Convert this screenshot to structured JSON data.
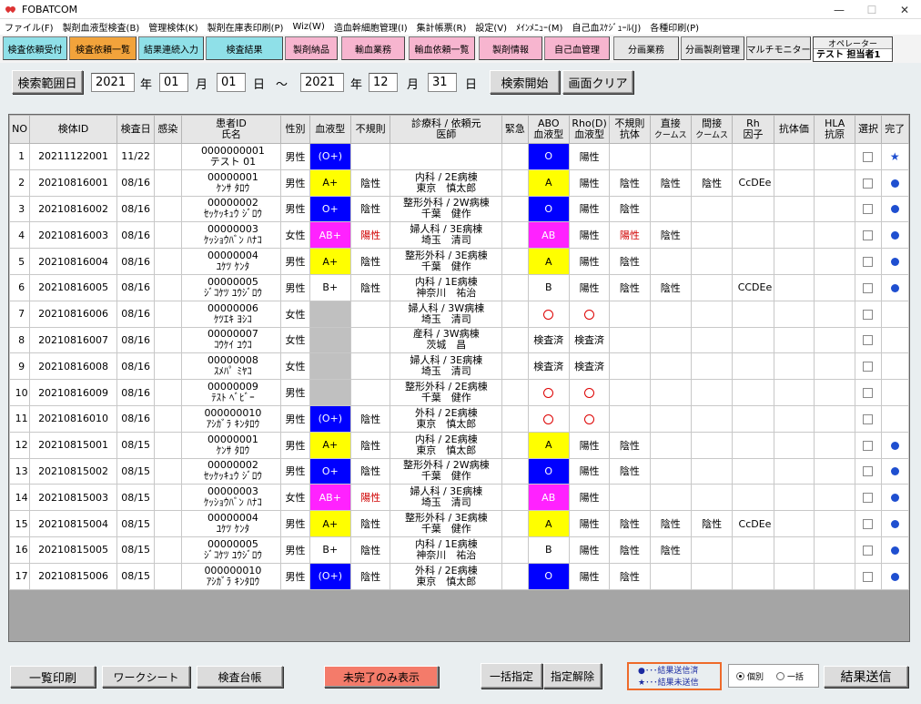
{
  "window": {
    "title": "FOBATCOM"
  },
  "menu": [
    "ファイル(F)",
    "製剤血液型検査(B)",
    "管理検体(K)",
    "製剤在庫表印刷(P)",
    "Wiz(W)",
    "造血幹細胞管理(I)",
    "集計帳票(R)",
    "設定(V)",
    "ﾒｲﾝﾒﾆｭｰ(M)",
    "自己血ｽｹｼﾞｭｰﾙ(J)",
    "各種印刷(P)"
  ],
  "tabs": [
    "検査依頼受付",
    "検査依頼一覧",
    "結果連続入力",
    "検査結果",
    "製剤納品",
    "輸血業務",
    "輸血依頼一覧",
    "製剤情報",
    "自己血管理",
    "分画業務",
    "分画製剤管理",
    "マルチモニター"
  ],
  "operator": {
    "label": "オペレーター",
    "name": "テスト 担当者1"
  },
  "search": {
    "range_button": "検索範囲日",
    "from_year": "2021",
    "from_month": "01",
    "from_day": "01",
    "to_year": "2021",
    "to_month": "12",
    "to_day": "31",
    "year_label": "年",
    "month_label": "月",
    "day_label": "日",
    "tilde": "～",
    "start_button": "検索開始",
    "clear_button": "画面クリア"
  },
  "columns": {
    "no": "NO",
    "sample_id": "検体ID",
    "exam_date": "検査日",
    "infection": "感染",
    "patient_id": "患者ID",
    "patient_name": "氏名",
    "sex": "性別",
    "blood_type": "血液型",
    "irregular": "不規則",
    "dept": "診療科 / 依頼元",
    "doctor": "医師",
    "urgent": "緊急",
    "abo1": "ABO",
    "abo2": "血液型",
    "rho1": "Rho(D)",
    "rho2": "血液型",
    "irr_ab1": "不規則",
    "irr_ab2": "抗体",
    "direct1": "直接",
    "direct2": "クームス",
    "indirect1": "間接",
    "indirect2": "クームス",
    "rh1": "Rh",
    "rh2": "因子",
    "titer": "抗体価",
    "hla1": "HLA",
    "hla2": "抗原",
    "select": "選択",
    "done": "完了"
  },
  "rows": [
    {
      "no": "1",
      "sid": "20211122001",
      "date": "11/22",
      "pid": "0000000001",
      "name": "テスト 01",
      "sex": "男性",
      "bt": "(O+)",
      "btc": "blue",
      "irr": "",
      "irrRed": false,
      "dept": "",
      "doc": "",
      "abo": "O",
      "aboc": "blue",
      "rho": "陽性",
      "irrab": "",
      "irrabRed": false,
      "direct": "",
      "indirect": "",
      "rh": "",
      "mark": "star"
    },
    {
      "no": "2",
      "sid": "20210816001",
      "date": "08/16",
      "pid": "00000001",
      "name": "ｹﾝｻ ﾀﾛｳ",
      "sex": "男性",
      "bt": "A+",
      "btc": "yellow",
      "irr": "陰性",
      "irrRed": false,
      "dept": "内科 / 2E病棟",
      "doc": "東京　慎太郎",
      "abo": "A",
      "aboc": "yellow",
      "rho": "陽性",
      "irrab": "陰性",
      "irrabRed": false,
      "direct": "陰性",
      "indirect": "陰性",
      "rh": "CcDEe",
      "mark": "dot"
    },
    {
      "no": "3",
      "sid": "20210816002",
      "date": "08/16",
      "pid": "00000002",
      "name": "ｾｯｹｯｷｭｳ ｼﾞﾛｳ",
      "sex": "男性",
      "bt": "O+",
      "btc": "blue",
      "irr": "陰性",
      "irrRed": false,
      "dept": "整形外科 / 2W病棟",
      "doc": "千葉　健作",
      "abo": "O",
      "aboc": "blue",
      "rho": "陽性",
      "irrab": "陰性",
      "irrabRed": false,
      "direct": "",
      "indirect": "",
      "rh": "",
      "mark": "dot"
    },
    {
      "no": "4",
      "sid": "20210816003",
      "date": "08/16",
      "pid": "00000003",
      "name": "ｹｯｼｮｳﾊﾞﾝ ﾊﾅｺ",
      "sex": "女性",
      "bt": "AB+",
      "btc": "magenta",
      "irr": "陽性",
      "irrRed": true,
      "dept": "婦人科 / 3E病棟",
      "doc": "埼玉　清司",
      "abo": "AB",
      "aboc": "magenta",
      "rho": "陽性",
      "irrab": "陽性",
      "irrabRed": true,
      "direct": "陰性",
      "indirect": "",
      "rh": "",
      "mark": "dot"
    },
    {
      "no": "5",
      "sid": "20210816004",
      "date": "08/16",
      "pid": "00000004",
      "name": "ﾕｹﾂ ｹﾝﾀ",
      "sex": "男性",
      "bt": "A+",
      "btc": "yellow",
      "irr": "陰性",
      "irrRed": false,
      "dept": "整形外科 / 3E病棟",
      "doc": "千葉　健作",
      "abo": "A",
      "aboc": "yellow",
      "rho": "陽性",
      "irrab": "陰性",
      "irrabRed": false,
      "direct": "",
      "indirect": "",
      "rh": "",
      "mark": "dot"
    },
    {
      "no": "6",
      "sid": "20210816005",
      "date": "08/16",
      "pid": "00000005",
      "name": "ｼﾞｺｹﾂ ﾕｳｼﾞﾛｳ",
      "sex": "男性",
      "bt": "B+",
      "btc": "",
      "irr": "陰性",
      "irrRed": false,
      "dept": "内科 / 1E病棟",
      "doc": "神奈川　祐治",
      "abo": "B",
      "aboc": "",
      "rho": "陽性",
      "irrab": "陰性",
      "irrabRed": false,
      "direct": "陰性",
      "indirect": "",
      "rh": "CCDEe",
      "mark": "dot"
    },
    {
      "no": "7",
      "sid": "20210816006",
      "date": "08/16",
      "pid": "00000006",
      "name": "ｹﾂｴｷ ﾖｼｺ",
      "sex": "女性",
      "bt": "",
      "btc": "gray",
      "irr": "",
      "irrRed": false,
      "dept": "婦人科 / 3W病棟",
      "doc": "埼玉　清司",
      "abo": "ring",
      "aboc": "",
      "rho": "ring",
      "irrab": "",
      "irrabRed": false,
      "direct": "",
      "indirect": "",
      "rh": "",
      "mark": ""
    },
    {
      "no": "8",
      "sid": "20210816007",
      "date": "08/16",
      "pid": "00000007",
      "name": "ｺｳｹｲ ﾕｳｺ",
      "sex": "女性",
      "bt": "",
      "btc": "gray",
      "irr": "",
      "irrRed": false,
      "dept": "産科 / 3W病棟",
      "doc": "茨城　昌",
      "abo": "検査済",
      "aboc": "",
      "rho": "検査済",
      "irrab": "",
      "irrabRed": false,
      "direct": "",
      "indirect": "",
      "rh": "",
      "mark": ""
    },
    {
      "no": "9",
      "sid": "20210816008",
      "date": "08/16",
      "pid": "00000008",
      "name": "ｽﾒﾊﾟ ﾐﾔｺ",
      "sex": "女性",
      "bt": "",
      "btc": "gray",
      "irr": "",
      "irrRed": false,
      "dept": "婦人科 / 3E病棟",
      "doc": "埼玉　清司",
      "abo": "検査済",
      "aboc": "",
      "rho": "検査済",
      "irrab": "",
      "irrabRed": false,
      "direct": "",
      "indirect": "",
      "rh": "",
      "mark": ""
    },
    {
      "no": "10",
      "sid": "20210816009",
      "date": "08/16",
      "pid": "00000009",
      "name": "ﾃｽﾄ ﾍﾞﾋﾞｰ",
      "sex": "男性",
      "bt": "",
      "btc": "gray",
      "irr": "",
      "irrRed": false,
      "dept": "整形外科 / 2E病棟",
      "doc": "千葉　健作",
      "abo": "ring",
      "aboc": "",
      "rho": "ring",
      "irrab": "",
      "irrabRed": false,
      "direct": "",
      "indirect": "",
      "rh": "",
      "mark": ""
    },
    {
      "no": "11",
      "sid": "20210816010",
      "date": "08/16",
      "pid": "000000010",
      "name": "ｱｼｶﾞﾗ ｷﾝﾀﾛｳ",
      "sex": "男性",
      "bt": "(O+)",
      "btc": "blue",
      "irr": "陰性",
      "irrRed": false,
      "dept": "外科 / 2E病棟",
      "doc": "東京　慎太郎",
      "abo": "ring",
      "aboc": "",
      "rho": "ring",
      "irrab": "",
      "irrabRed": false,
      "direct": "",
      "indirect": "",
      "rh": "",
      "mark": ""
    },
    {
      "no": "12",
      "sid": "20210815001",
      "date": "08/15",
      "pid": "00000001",
      "name": "ｹﾝｻ ﾀﾛｳ",
      "sex": "男性",
      "bt": "A+",
      "btc": "yellow",
      "irr": "陰性",
      "irrRed": false,
      "dept": "内科 / 2E病棟",
      "doc": "東京　慎太郎",
      "abo": "A",
      "aboc": "yellow",
      "rho": "陽性",
      "irrab": "陰性",
      "irrabRed": false,
      "direct": "",
      "indirect": "",
      "rh": "",
      "mark": "dot"
    },
    {
      "no": "13",
      "sid": "20210815002",
      "date": "08/15",
      "pid": "00000002",
      "name": "ｾｯｹｯｷｭｳ ｼﾞﾛｳ",
      "sex": "男性",
      "bt": "O+",
      "btc": "blue",
      "irr": "陰性",
      "irrRed": false,
      "dept": "整形外科 / 2W病棟",
      "doc": "千葉　健作",
      "abo": "O",
      "aboc": "blue",
      "rho": "陽性",
      "irrab": "陰性",
      "irrabRed": false,
      "direct": "",
      "indirect": "",
      "rh": "",
      "mark": "dot"
    },
    {
      "no": "14",
      "sid": "20210815003",
      "date": "08/15",
      "pid": "00000003",
      "name": "ｹｯｼｮｳﾊﾞﾝ ﾊﾅｺ",
      "sex": "女性",
      "bt": "AB+",
      "btc": "magenta",
      "irr": "陽性",
      "irrRed": true,
      "dept": "婦人科 / 3E病棟",
      "doc": "埼玉　清司",
      "abo": "AB",
      "aboc": "magenta",
      "rho": "陽性",
      "irrab": "",
      "irrabRed": false,
      "direct": "",
      "indirect": "",
      "rh": "",
      "mark": "dot"
    },
    {
      "no": "15",
      "sid": "20210815004",
      "date": "08/15",
      "pid": "00000004",
      "name": "ﾕｹﾂ ｹﾝﾀ",
      "sex": "男性",
      "bt": "A+",
      "btc": "yellow",
      "irr": "陰性",
      "irrRed": false,
      "dept": "整形外科 / 3E病棟",
      "doc": "千葉　健作",
      "abo": "A",
      "aboc": "yellow",
      "rho": "陽性",
      "irrab": "陰性",
      "irrabRed": false,
      "direct": "陰性",
      "indirect": "陰性",
      "rh": "CcDEe",
      "mark": "dot"
    },
    {
      "no": "16",
      "sid": "20210815005",
      "date": "08/15",
      "pid": "00000005",
      "name": "ｼﾞｺｹﾂ ﾕｳｼﾞﾛｳ",
      "sex": "男性",
      "bt": "B+",
      "btc": "",
      "irr": "陰性",
      "irrRed": false,
      "dept": "内科 / 1E病棟",
      "doc": "神奈川　祐治",
      "abo": "B",
      "aboc": "",
      "rho": "陽性",
      "irrab": "陰性",
      "irrabRed": false,
      "direct": "陰性",
      "indirect": "",
      "rh": "",
      "mark": "dot"
    },
    {
      "no": "17",
      "sid": "20210815006",
      "date": "08/15",
      "pid": "000000010",
      "name": "ｱｼｶﾞﾗ ｷﾝﾀﾛｳ",
      "sex": "男性",
      "bt": "(O+)",
      "btc": "blue",
      "irr": "陰性",
      "irrRed": false,
      "dept": "外科 / 2E病棟",
      "doc": "東京　慎太郎",
      "abo": "O",
      "aboc": "blue",
      "rho": "陽性",
      "irrab": "陰性",
      "irrabRed": false,
      "direct": "",
      "indirect": "",
      "rh": "",
      "mark": "dot"
    }
  ],
  "footer": {
    "print_list": "一覧印刷",
    "worksheet": "ワークシート",
    "ledger": "検査台帳",
    "incomplete_only": "未完了のみ表示",
    "bulk_select": "一括指定",
    "deselect": "指定解除",
    "legend_sent": "●･･･結果送信済",
    "legend_unsent": "★･･･結果未送信",
    "radio_individual": "個別",
    "radio_bulk": "一括",
    "send_results": "結果送信"
  },
  "colors": {
    "blue": "#0000ff",
    "yellow": "#ffff00",
    "magenta": "#ff22ff",
    "gray": "#c0c0c0",
    "legend_border": "#ee6a2a"
  }
}
